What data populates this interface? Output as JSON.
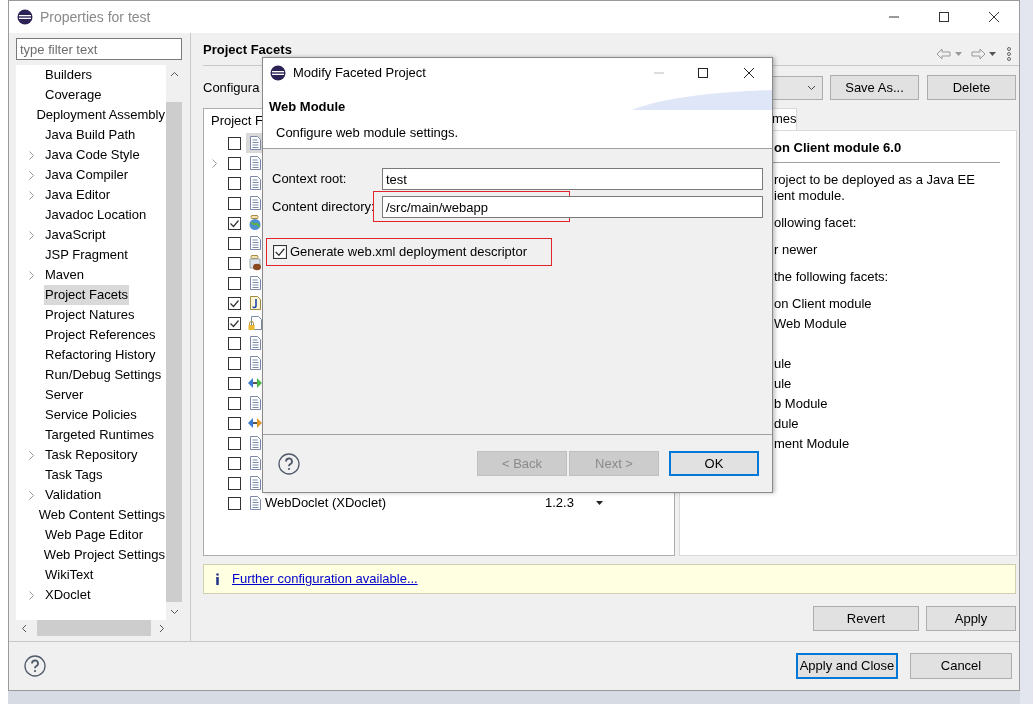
{
  "window": {
    "title": "Properties for test"
  },
  "sidebar": {
    "filter": {
      "placeholder": "type filter text"
    },
    "items": [
      {
        "label": "Builders",
        "kind": "leaf",
        "selected": false
      },
      {
        "label": "Coverage",
        "kind": "leaf",
        "selected": false
      },
      {
        "label": "Deployment Assembly",
        "kind": "leaf",
        "selected": false
      },
      {
        "label": "Java Build Path",
        "kind": "leaf",
        "selected": false
      },
      {
        "label": "Java Code Style",
        "kind": "group",
        "selected": false
      },
      {
        "label": "Java Compiler",
        "kind": "group",
        "selected": false
      },
      {
        "label": "Java Editor",
        "kind": "group",
        "selected": false
      },
      {
        "label": "Javadoc Location",
        "kind": "leaf",
        "selected": false
      },
      {
        "label": "JavaScript",
        "kind": "group",
        "selected": false
      },
      {
        "label": "JSP Fragment",
        "kind": "leaf",
        "selected": false
      },
      {
        "label": "Maven",
        "kind": "group",
        "selected": false
      },
      {
        "label": "Project Facets",
        "kind": "leaf",
        "selected": true
      },
      {
        "label": "Project Natures",
        "kind": "leaf",
        "selected": false
      },
      {
        "label": "Project References",
        "kind": "leaf",
        "selected": false
      },
      {
        "label": "Refactoring History",
        "kind": "leaf",
        "selected": false
      },
      {
        "label": "Run/Debug Settings",
        "kind": "leaf",
        "selected": false
      },
      {
        "label": "Server",
        "kind": "leaf",
        "selected": false
      },
      {
        "label": "Service Policies",
        "kind": "leaf",
        "selected": false
      },
      {
        "label": "Targeted Runtimes",
        "kind": "leaf",
        "selected": false
      },
      {
        "label": "Task Repository",
        "kind": "group",
        "selected": false
      },
      {
        "label": "Task Tags",
        "kind": "leaf",
        "selected": false
      },
      {
        "label": "Validation",
        "kind": "group",
        "selected": false
      },
      {
        "label": "Web Content Settings",
        "kind": "leaf",
        "selected": false
      },
      {
        "label": "Web Page Editor",
        "kind": "leaf",
        "selected": false
      },
      {
        "label": "Web Project Settings",
        "kind": "leaf",
        "selected": false
      },
      {
        "label": "WikiText",
        "kind": "leaf",
        "selected": false
      },
      {
        "label": "XDoclet",
        "kind": "group",
        "selected": false
      }
    ]
  },
  "page": {
    "title": "Project Facets",
    "configuration_label": "Configura",
    "buttons": [
      "Save As...",
      "Delete"
    ],
    "facets": {
      "header": "Project F",
      "rows": [
        {
          "checked": false,
          "kind": "doc",
          "expandable": false,
          "selected": true
        },
        {
          "checked": false,
          "kind": "doc",
          "expandable": true,
          "selected": false
        },
        {
          "checked": false,
          "kind": "doc",
          "expandable": false,
          "selected": false
        },
        {
          "checked": false,
          "kind": "doc",
          "expandable": false,
          "selected": false
        },
        {
          "checked": true,
          "kind": "globe",
          "expandable": false,
          "selected": false
        },
        {
          "checked": false,
          "kind": "doc",
          "expandable": false,
          "selected": false
        },
        {
          "checked": false,
          "kind": "bean",
          "expandable": false,
          "selected": false
        },
        {
          "checked": false,
          "kind": "doc",
          "expandable": false,
          "selected": false
        },
        {
          "checked": true,
          "kind": "java",
          "expandable": false,
          "selected": false
        },
        {
          "checked": true,
          "kind": "lock",
          "expandable": false,
          "selected": false
        },
        {
          "checked": false,
          "kind": "doc",
          "expandable": false,
          "selected": false
        },
        {
          "checked": false,
          "kind": "doc",
          "expandable": false,
          "selected": false
        },
        {
          "checked": false,
          "kind": "arrows",
          "expandable": false,
          "selected": false
        },
        {
          "checked": false,
          "kind": "doc",
          "expandable": false,
          "selected": false
        },
        {
          "checked": false,
          "kind": "link",
          "expandable": false,
          "selected": false
        },
        {
          "checked": false,
          "kind": "doc",
          "expandable": false,
          "selected": false
        },
        {
          "checked": false,
          "kind": "doc",
          "expandable": false,
          "selected": false
        },
        {
          "checked": false,
          "kind": "doc",
          "expandable": false,
          "selected": false
        },
        {
          "checked": false,
          "kind": "doc",
          "expandable": false,
          "selected": false,
          "name": "WebDoclet (XDoclet)",
          "version": "1.2.3"
        }
      ]
    },
    "details": {
      "tab": "mes",
      "title": "on Client module 6.0",
      "lines": [
        {
          "text": "roject to be deployed as a Java EE",
          "kind": "para"
        },
        {
          "text": "ient module.",
          "kind": "cont"
        },
        {
          "text": "ollowing facet:",
          "kind": "para"
        },
        {
          "text": "r newer",
          "kind": "para"
        },
        {
          "text": "the following facets:",
          "kind": "para"
        },
        {
          "text": "on Client module",
          "kind": "para"
        },
        {
          "text": "Web Module",
          "kind": "item"
        },
        {
          "text": "ule",
          "kind": "section"
        },
        {
          "text": "ule",
          "kind": "item"
        },
        {
          "text": "b Module",
          "kind": "item"
        },
        {
          "text": "dule",
          "kind": "item"
        },
        {
          "text": "ment Module",
          "kind": "item"
        }
      ]
    },
    "info": {
      "link": "Further configuration available..."
    },
    "actions": [
      "Revert",
      "Apply"
    ]
  },
  "footer": {
    "buttons": [
      {
        "label": "Apply and Close",
        "default": true
      },
      {
        "label": "Cancel",
        "default": false
      }
    ]
  },
  "dialog": {
    "title": "Modify Faceted Project",
    "heading": "Web Module",
    "description": "Configure web module settings.",
    "fields": [
      {
        "label": "Context root:",
        "value": "test",
        "highlighted": false
      },
      {
        "label": "Content directory:",
        "value": "/src/main/webapp",
        "highlighted": true
      }
    ],
    "option": {
      "label": "Generate web.xml deployment descriptor",
      "checked": true,
      "highlighted": true
    },
    "buttons": [
      {
        "label": "< Back",
        "disabled": true,
        "default": false
      },
      {
        "label": "Next >",
        "disabled": true,
        "default": false
      },
      {
        "label": "OK",
        "disabled": false,
        "default": true
      }
    ]
  }
}
